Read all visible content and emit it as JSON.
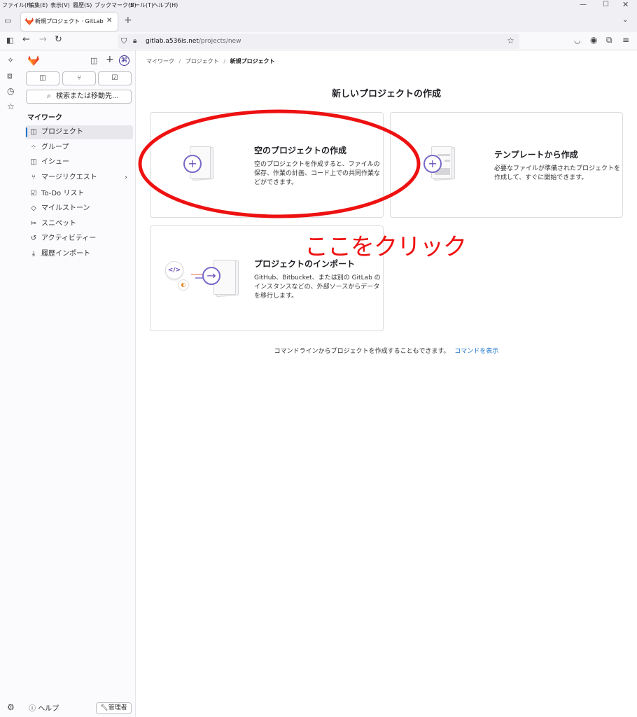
{
  "browser": {
    "menu": [
      "ファイル(F)",
      "編集(E)",
      "表示(V)",
      "履歴(S)",
      "ブックマーク(B)",
      "ツール(T)",
      "ヘルプ(H)"
    ],
    "tab_title": "新規プロジェクト · GitLab",
    "url_host": "gitlab.a536is.net",
    "url_path": "/projects/new"
  },
  "sidebar": {
    "search_label": "検索または移動先...",
    "section_title": "マイワーク",
    "items": [
      {
        "label": "プロジェクト",
        "icon": "project-icon"
      },
      {
        "label": "グループ",
        "icon": "group-icon"
      },
      {
        "label": "イシュー",
        "icon": "issue-icon"
      },
      {
        "label": "マージリクエスト",
        "icon": "merge-request-icon"
      },
      {
        "label": "To-Do リスト",
        "icon": "todo-icon"
      },
      {
        "label": "マイルストーン",
        "icon": "milestone-icon"
      },
      {
        "label": "スニペット",
        "icon": "snippet-icon"
      },
      {
        "label": "アクティビティー",
        "icon": "activity-icon"
      },
      {
        "label": "履歴インポート",
        "icon": "import-icon"
      }
    ],
    "help_label": "ヘルプ",
    "admin_label": "管理者"
  },
  "breadcrumb": [
    "マイワーク",
    "プロジェクト",
    "新規プロジェクト"
  ],
  "page_title": "新しいプロジェクトの作成",
  "cards": {
    "blank": {
      "title": "空のプロジェクトの作成",
      "desc_lines": [
        "空のプロジェクトを作成すると、ファイルの",
        "保存、作業の計画、コード上での共同作業な",
        "どができます。"
      ]
    },
    "template": {
      "title": "テンプレートから作成",
      "desc_lines": [
        "必要なファイルが準備されたプロジェクトを",
        "作成して、すぐに開始できます。"
      ]
    },
    "import": {
      "title": "プロジェクトのインポート",
      "desc_lines": [
        "GitHub、Bitbucket、または別の GitLab の",
        "インスタンスなどの、外部ソースからデータ",
        "を移行します。"
      ]
    }
  },
  "footer_text": "コマンドラインからプロジェクトを作成することもできます。",
  "footer_link": "コマンドを表示",
  "annotation": {
    "text": "ここをクリック",
    "color": "#ee1111"
  },
  "colors": {
    "accent": "#1f75cb",
    "illustration": "#6b4fbb"
  }
}
